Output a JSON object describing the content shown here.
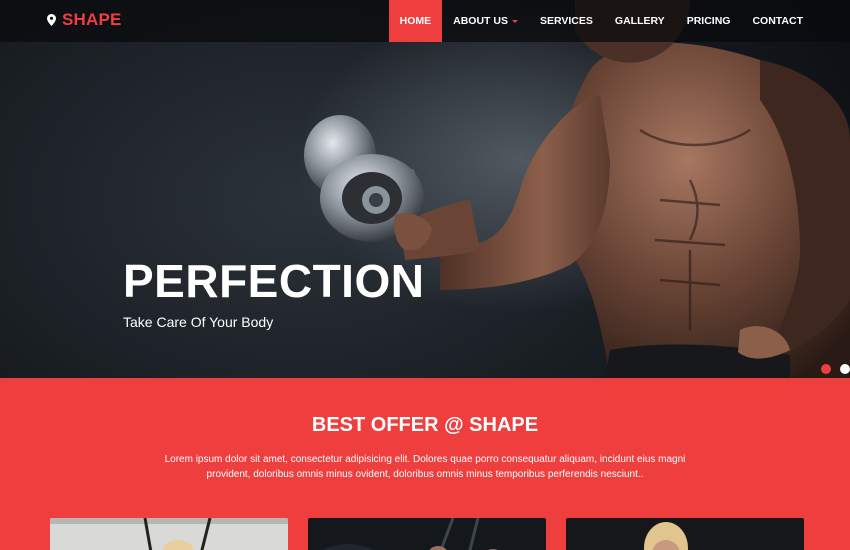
{
  "brand": {
    "name": "SHAPE",
    "icon": "map-pin-icon",
    "color": "#ee3e3e"
  },
  "nav": {
    "items": [
      {
        "label": "HOME",
        "active": true
      },
      {
        "label": "ABOUT US",
        "dropdown": true
      },
      {
        "label": "SERVICES"
      },
      {
        "label": "GALLERY"
      },
      {
        "label": "PRICING"
      },
      {
        "label": "CONTACT"
      }
    ]
  },
  "hero": {
    "title": "PERFECTION",
    "subtitle": "Take Care Of Your Body",
    "slides": 2,
    "active_slide": 1
  },
  "offer": {
    "title": "BEST OFFER @ SHAPE",
    "text": "Lorem ipsum dolor sit amet, consectetur adipisicing elit. Dolores quae porro consequatur aliquam, incidunt eius magni provident, doloribus omnis minus ovident, doloribus omnis minus temporibus perferendis nesciunt..",
    "accent": "#ee3e3e"
  }
}
